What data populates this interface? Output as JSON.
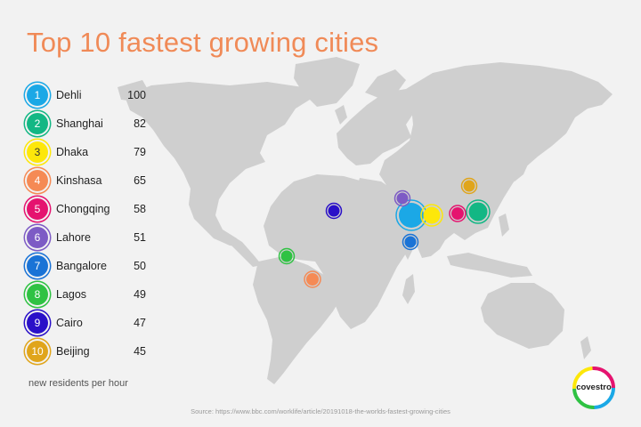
{
  "title": "Top 10 fastest growing cities",
  "caption": "new residents per hour",
  "source": "Source: https://www.bbc.com/worklife/article/20191018-the-worlds-fastest-growing-cities",
  "brand": "covestro",
  "cities": [
    {
      "rank": "1",
      "name": "Dehli",
      "value": "100",
      "color": "#1ba8e6"
    },
    {
      "rank": "2",
      "name": "Shanghai",
      "value": "82",
      "color": "#13b784"
    },
    {
      "rank": "3",
      "name": "Dhaka",
      "value": "79",
      "color": "#fde70a"
    },
    {
      "rank": "4",
      "name": "Kinshasa",
      "value": "65",
      "color": "#f58a55"
    },
    {
      "rank": "5",
      "name": "Chongqing",
      "value": "58",
      "color": "#e5136f"
    },
    {
      "rank": "6",
      "name": "Lahore",
      "value": "51",
      "color": "#7d5bc5"
    },
    {
      "rank": "7",
      "name": "Bangalore",
      "value": "50",
      "color": "#1a73d6"
    },
    {
      "rank": "8",
      "name": "Lagos",
      "value": "49",
      "color": "#2fc243"
    },
    {
      "rank": "9",
      "name": "Cairo",
      "value": "47",
      "color": "#2a10c8"
    },
    {
      "rank": "10",
      "name": "Beijing",
      "value": "45",
      "color": "#e0a51b"
    }
  ]
}
